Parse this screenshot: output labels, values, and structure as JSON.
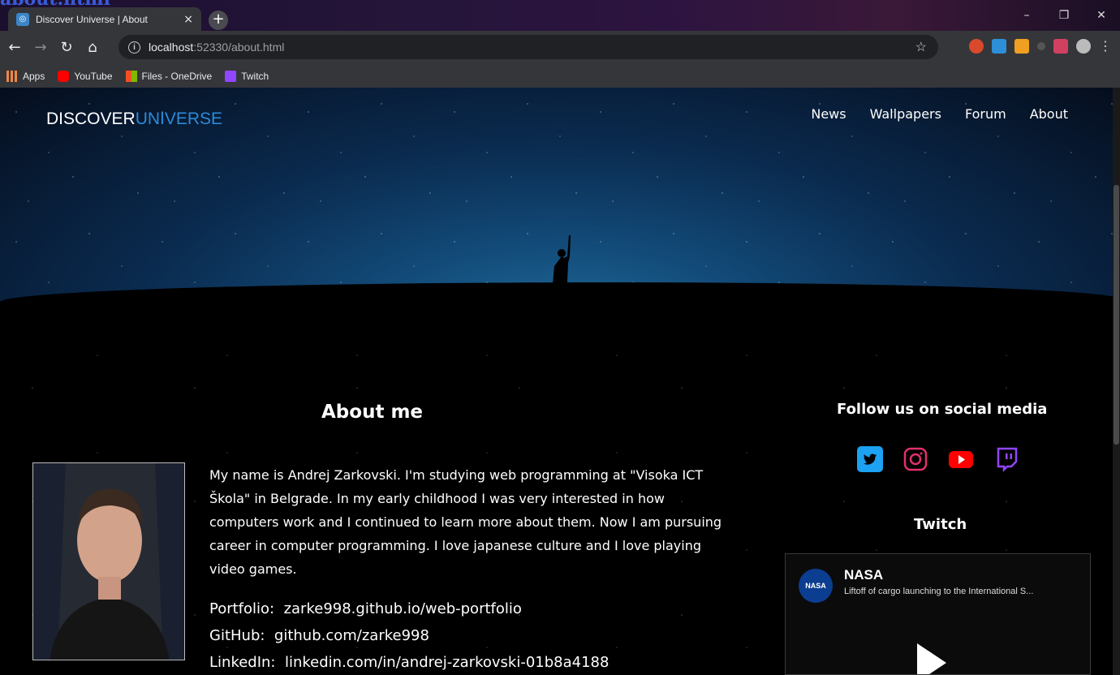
{
  "top_peek": "about.html",
  "browser": {
    "tab_title": "Discover Universe | About",
    "tab_close": "×",
    "new_tab": "+",
    "url_host": "localhost",
    "url_rest": ":52330/about.html",
    "bookmarks": [
      "Apps",
      "YouTube",
      "Files - OneDrive",
      "Twitch"
    ],
    "window_controls": [
      "–",
      "❐",
      "✕"
    ]
  },
  "brand": {
    "part1": "DISCOVER",
    "part2": "UNIVERSE"
  },
  "nav": [
    "News",
    "Wallpapers",
    "Forum",
    "About"
  ],
  "about": {
    "title": "About me",
    "text": "My name is Andrej Zarkovski. I'm studying web programming at \"Visoka ICT Škola\" in Belgrade. In my early childhood I was very interested in how computers work and I continued to learn more about them. Now I am pursuing career in computer programming. I love japanese culture and I love playing video games.",
    "links": [
      {
        "label": "Portfolio:",
        "value": "zarke998.github.io/web-portfolio"
      },
      {
        "label": "GitHub:",
        "value": "github.com/zarke998"
      },
      {
        "label": "LinkedIn:",
        "value": "linkedin.com/in/andrej-zarkovski-01b8a4188"
      }
    ]
  },
  "social": {
    "title": "Follow us on social media",
    "icons": [
      "twitter-icon",
      "instagram-icon",
      "youtube-icon",
      "twitch-icon"
    ]
  },
  "twitch": {
    "title": "Twitch",
    "channel": "NASA",
    "logo_text": "NASA",
    "description": "Liftoff of cargo launching to the International S..."
  },
  "colors": {
    "accent": "#2b8ad8",
    "twitter": "#1da1f2",
    "instagram": "#e1306c",
    "youtube": "#ff0000",
    "twitch": "#9146ff"
  }
}
